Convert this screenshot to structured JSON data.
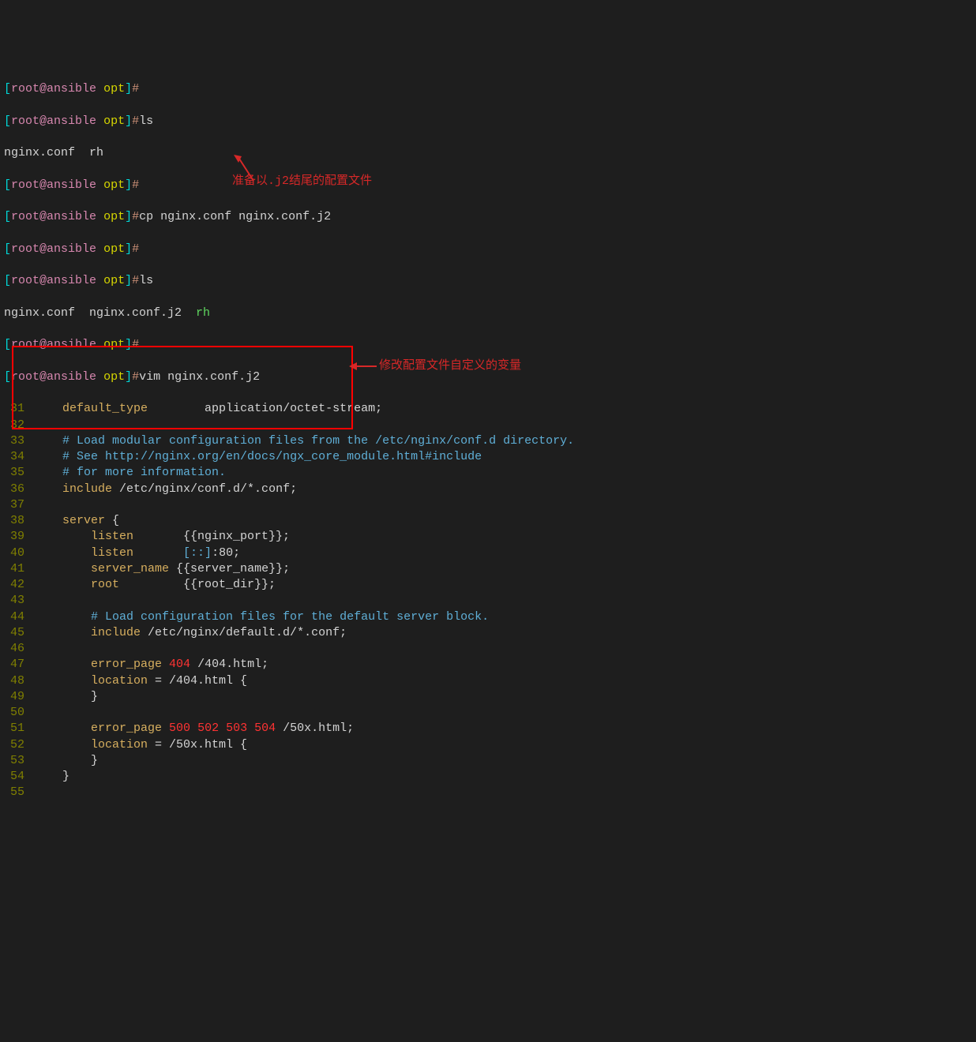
{
  "prompts": {
    "p1": {
      "bracket_open": "[",
      "user_host": "root@ansible",
      "dir": "opt",
      "bracket_close": "]",
      "hash": "#"
    },
    "p2_cmd": "ls",
    "p3_output": "nginx.conf  rh",
    "p5_cmd": "cp nginx.conf nginx.conf.j2",
    "p7_cmd": "ls",
    "p8_output_pre": "nginx.conf  nginx.conf.j2  ",
    "p8_output_rh": "rh",
    "p10_cmd": "vim nginx.conf.j2"
  },
  "annotations": {
    "a1": "准备以.j2结尾的配置文件",
    "a2": "修改配置文件自定义的变量"
  },
  "code_lines": [
    {
      "num": "31",
      "segments": [
        {
          "text": "    ",
          "class": "white"
        },
        {
          "text": "default_type",
          "class": "ochre"
        },
        {
          "text": "        application/octet-stream;",
          "class": "white"
        }
      ]
    },
    {
      "num": "32",
      "segments": []
    },
    {
      "num": "33",
      "segments": [
        {
          "text": "    ",
          "class": "white"
        },
        {
          "text": "# Load modular configuration files from the /etc/nginx/conf.d directory.",
          "class": "lightblue"
        }
      ]
    },
    {
      "num": "34",
      "segments": [
        {
          "text": "    ",
          "class": "white"
        },
        {
          "text": "# See http://nginx.org/en/docs/ngx_core_module.html#include",
          "class": "lightblue"
        }
      ]
    },
    {
      "num": "35",
      "segments": [
        {
          "text": "    ",
          "class": "white"
        },
        {
          "text": "# for more information.",
          "class": "lightblue"
        }
      ]
    },
    {
      "num": "36",
      "segments": [
        {
          "text": "    ",
          "class": "white"
        },
        {
          "text": "include",
          "class": "ochre"
        },
        {
          "text": " /etc/nginx/conf.d/*.conf;",
          "class": "white"
        }
      ]
    },
    {
      "num": "37",
      "segments": []
    },
    {
      "num": "38",
      "segments": [
        {
          "text": "    ",
          "class": "white"
        },
        {
          "text": "server",
          "class": "ochre"
        },
        {
          "text": " {",
          "class": "white"
        }
      ]
    },
    {
      "num": "39",
      "segments": [
        {
          "text": "        ",
          "class": "white"
        },
        {
          "text": "listen",
          "class": "ochre"
        },
        {
          "text": "       {{nginx_port}};",
          "class": "white"
        }
      ]
    },
    {
      "num": "40",
      "segments": [
        {
          "text": "        ",
          "class": "white"
        },
        {
          "text": "listen",
          "class": "ochre"
        },
        {
          "text": "       ",
          "class": "white"
        },
        {
          "text": "[::]",
          "class": "lightblue"
        },
        {
          "text": ":80;",
          "class": "white"
        }
      ]
    },
    {
      "num": "41",
      "segments": [
        {
          "text": "        ",
          "class": "white"
        },
        {
          "text": "server_name",
          "class": "ochre"
        },
        {
          "text": " {{server_name}};",
          "class": "white"
        }
      ]
    },
    {
      "num": "42",
      "segments": [
        {
          "text": "        ",
          "class": "white"
        },
        {
          "text": "root",
          "class": "ochre"
        },
        {
          "text": "         {{root_dir}};",
          "class": "white"
        }
      ]
    },
    {
      "num": "43",
      "segments": []
    },
    {
      "num": "44",
      "segments": [
        {
          "text": "        ",
          "class": "white"
        },
        {
          "text": "# Load configuration files for the default server block.",
          "class": "lightblue"
        }
      ]
    },
    {
      "num": "45",
      "segments": [
        {
          "text": "        ",
          "class": "white"
        },
        {
          "text": "include",
          "class": "ochre"
        },
        {
          "text": " /etc/nginx/default.d/*.conf;",
          "class": "white"
        }
      ]
    },
    {
      "num": "46",
      "segments": []
    },
    {
      "num": "47",
      "segments": [
        {
          "text": "        ",
          "class": "white"
        },
        {
          "text": "error_page",
          "class": "ochre"
        },
        {
          "text": " ",
          "class": "white"
        },
        {
          "text": "404",
          "class": "red"
        },
        {
          "text": " /404.html;",
          "class": "white"
        }
      ]
    },
    {
      "num": "48",
      "segments": [
        {
          "text": "        ",
          "class": "white"
        },
        {
          "text": "location",
          "class": "ochre"
        },
        {
          "text": " = /404.html {",
          "class": "white"
        }
      ]
    },
    {
      "num": "49",
      "segments": [
        {
          "text": "        }",
          "class": "white"
        }
      ]
    },
    {
      "num": "50",
      "segments": []
    },
    {
      "num": "51",
      "segments": [
        {
          "text": "        ",
          "class": "white"
        },
        {
          "text": "error_page",
          "class": "ochre"
        },
        {
          "text": " ",
          "class": "white"
        },
        {
          "text": "500",
          "class": "red"
        },
        {
          "text": " ",
          "class": "white"
        },
        {
          "text": "502",
          "class": "red"
        },
        {
          "text": " ",
          "class": "white"
        },
        {
          "text": "503",
          "class": "red"
        },
        {
          "text": " ",
          "class": "white"
        },
        {
          "text": "504",
          "class": "red"
        },
        {
          "text": " /50x.html;",
          "class": "white"
        }
      ]
    },
    {
      "num": "52",
      "segments": [
        {
          "text": "        ",
          "class": "white"
        },
        {
          "text": "location",
          "class": "ochre"
        },
        {
          "text": " = /50x.html {",
          "class": "white"
        }
      ]
    },
    {
      "num": "53",
      "segments": [
        {
          "text": "        }",
          "class": "white"
        }
      ]
    },
    {
      "num": "54",
      "segments": [
        {
          "text": "    }",
          "class": "white"
        }
      ]
    },
    {
      "num": "55",
      "segments": []
    }
  ]
}
